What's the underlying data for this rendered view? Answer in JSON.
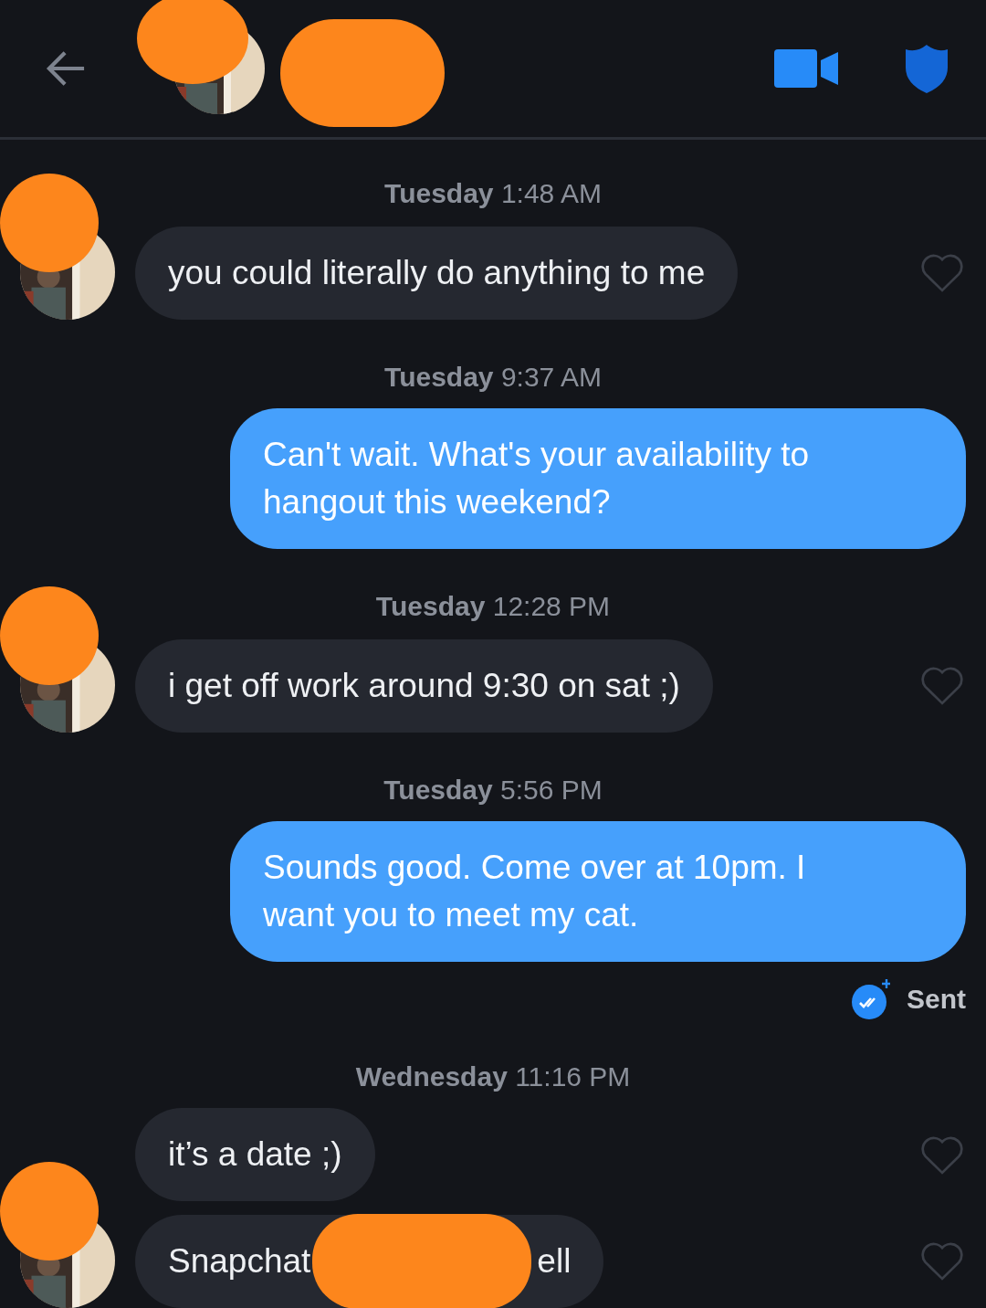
{
  "groups": [
    {
      "day": "Tuesday",
      "time": "1:48 AM",
      "messages": [
        {
          "kind": "received",
          "text": "you could literally do anything to me",
          "avatar": true
        }
      ]
    },
    {
      "day": "Tuesday",
      "time": "9:37 AM",
      "messages": [
        {
          "kind": "sent",
          "text": "Can't wait. What's your availability to hangout this weekend?"
        }
      ]
    },
    {
      "day": "Tuesday",
      "time": "12:28 PM",
      "messages": [
        {
          "kind": "received",
          "text": "i get off work around 9:30 on sat ;)",
          "avatar": true
        }
      ]
    },
    {
      "day": "Tuesday",
      "time": "5:56 PM",
      "messages": [
        {
          "kind": "sent",
          "text": "Sounds good. Come over at 10pm. I want you to meet my cat.",
          "status": "Sent"
        }
      ]
    },
    {
      "day": "Wednesday",
      "time": "11:16 PM",
      "messages": [
        {
          "kind": "received",
          "text": "it’s a date ;)",
          "avatar": false
        },
        {
          "kind": "received",
          "text": "Snapchat",
          "text_after": "ell",
          "avatar": true
        }
      ]
    }
  ]
}
